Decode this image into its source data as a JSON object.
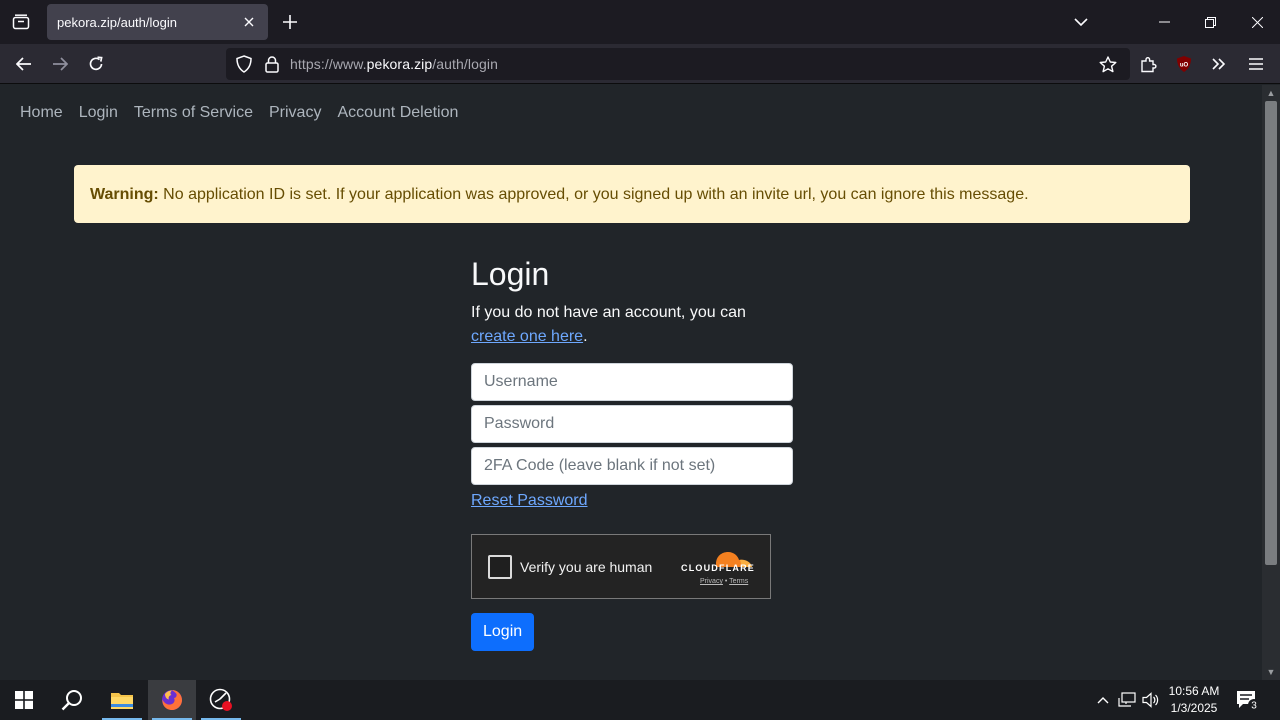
{
  "browser": {
    "tab_title": "pekora.zip/auth/login",
    "url_prefix": "https://www.",
    "url_host": "pekora.zip",
    "url_path": "/auth/login"
  },
  "site_nav": [
    "Home",
    "Login",
    "Terms of Service",
    "Privacy",
    "Account Deletion"
  ],
  "alert": {
    "label": "Warning:",
    "message": " No application ID is set. If your application was approved, or you signed up with an invite url, you can ignore this message."
  },
  "login": {
    "title": "Login",
    "sub_text": "If you do not have an account, you can ",
    "create_link": "create one here",
    "sub_end": ".",
    "username_placeholder": "Username",
    "password_placeholder": "Password",
    "twofa_placeholder": "2FA Code (leave blank if not set)",
    "reset_link": "Reset Password",
    "button": "Login"
  },
  "captcha": {
    "label": "Verify you are human",
    "brand": "CLOUDFLARE",
    "privacy": "Privacy",
    "separator": " • ",
    "terms": "Terms"
  },
  "taskbar": {
    "time": "10:56 AM",
    "date": "1/3/2025",
    "notifications": "3"
  },
  "colors": {
    "page_bg": "#212529",
    "warning_bg": "#fff3cd",
    "primary": "#0d6efd",
    "link": "#6ea8fe"
  }
}
